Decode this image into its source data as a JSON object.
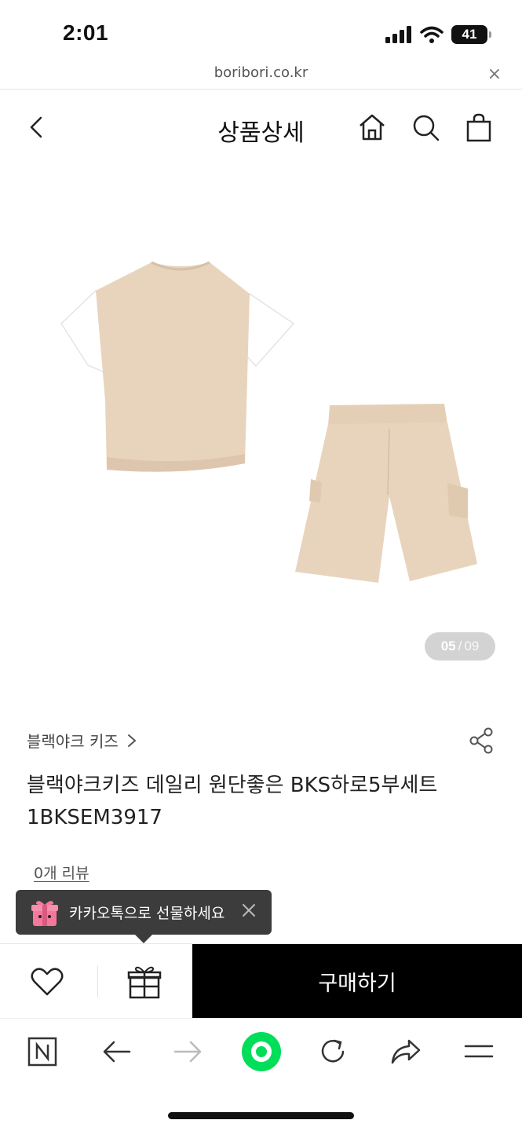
{
  "status_bar": {
    "time": "2:01",
    "battery": "41"
  },
  "url_bar": {
    "domain": "boribori.co.kr",
    "close_label": "×"
  },
  "header": {
    "title": "상품상세"
  },
  "gallery": {
    "current": "05",
    "separator": "/",
    "total": "09"
  },
  "product": {
    "brand": "블랙야크 키즈",
    "name": "블랙야크키즈 데일리 원단좋은 BKS하로5부세트 1BKSEM3917",
    "reviews_label": "0개 리뷰",
    "colors": {
      "garment": "#E8D4BD",
      "sleeve": "#FFFFFF"
    }
  },
  "gift_tooltip": {
    "text": "카카오톡으로 선물하세요"
  },
  "purchase_bar": {
    "buy_label": "구매하기"
  },
  "browser_toolbar": {
    "items": [
      "naver-n-icon",
      "back-arrow-icon",
      "forward-arrow-icon",
      "green-dot-icon",
      "refresh-icon",
      "share-icon",
      "menu-icon"
    ]
  },
  "colors": {
    "accent": "#00DE5A",
    "buy_button": "#000000",
    "tooltip_bg": "#3C3C3C"
  }
}
